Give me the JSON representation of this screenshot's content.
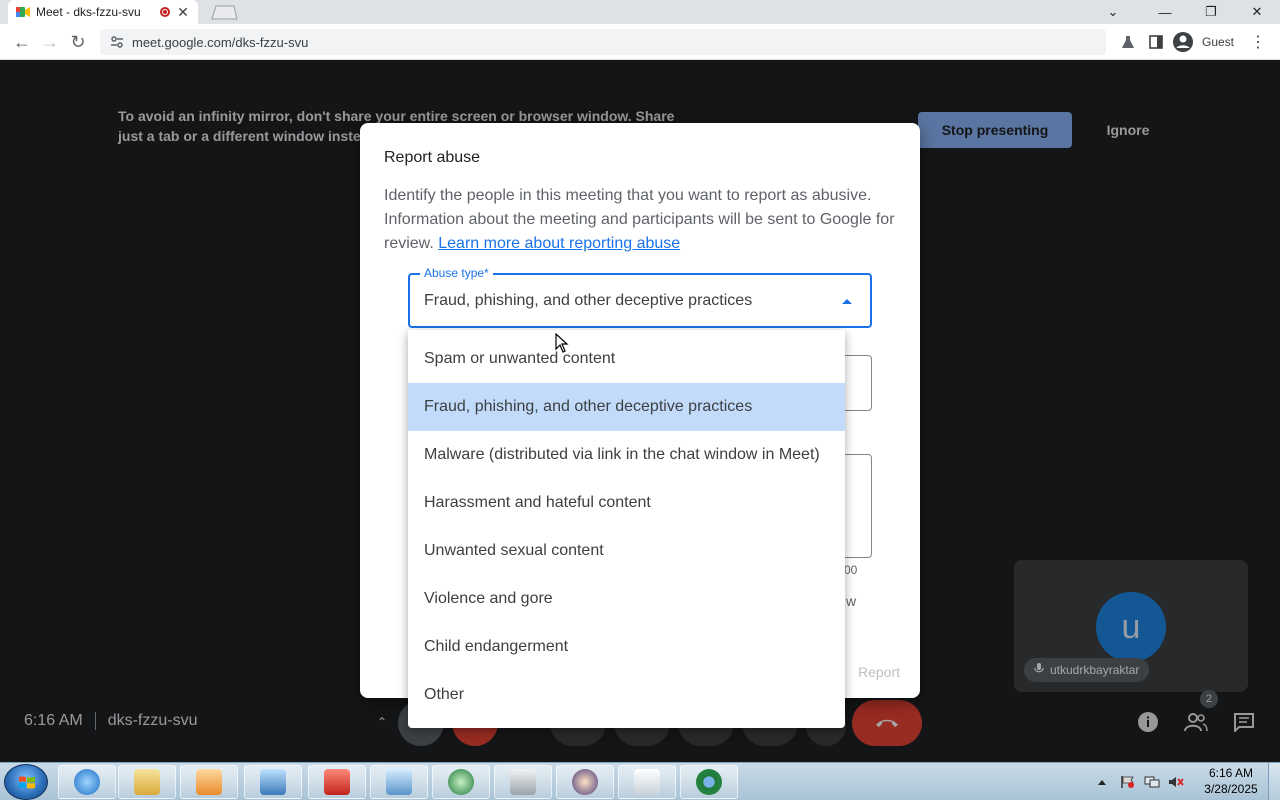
{
  "browser": {
    "tab_title": "Meet - dks-fzzu-svu",
    "url": "meet.google.com/dks-fzzu-svu",
    "profile_label": "Guest"
  },
  "meet": {
    "banner_text": "To avoid an infinity mirror, don't share your entire screen or browser window. Share just a tab or a different window instead.",
    "stop_presenting_label": "Stop presenting",
    "ignore_label": "Ignore",
    "time": "6:16 AM",
    "meeting_code": "dks-fzzu-svu",
    "participant_count": "2",
    "self_tile": {
      "initial": "u",
      "name": "utkudrkbayraktar"
    }
  },
  "dialog": {
    "title": "Report abuse",
    "description": "Identify the people in this meeting that you want to report as abusive. Information about the meeting and participants will be sent to Google for review.",
    "learn_more_link": "Learn more about reporting abuse",
    "abuse_type_label": "Abuse type*",
    "abuse_type_value": "Fraud, phishing, and other deceptive practices",
    "counter_fragment": "00",
    "text_fragment": "w",
    "report_label": "Report",
    "options": [
      "Spam or unwanted content",
      "Fraud, phishing, and other deceptive practices",
      "Malware (distributed via link in the chat window in Meet)",
      "Harassment and hateful content",
      "Unwanted sexual content",
      "Violence and gore",
      "Child endangerment",
      "Other"
    ],
    "selected_option_index": 1
  },
  "taskbar": {
    "clock_time": "6:16 AM",
    "clock_date": "3/28/2025"
  },
  "colors": {
    "accent": "#1a73e8",
    "selected_option_bg": "#c2dbfa",
    "stop_presenting_bg": "#8ab4f8",
    "end_call": "#ea4335",
    "meet_bg": "#202124"
  }
}
